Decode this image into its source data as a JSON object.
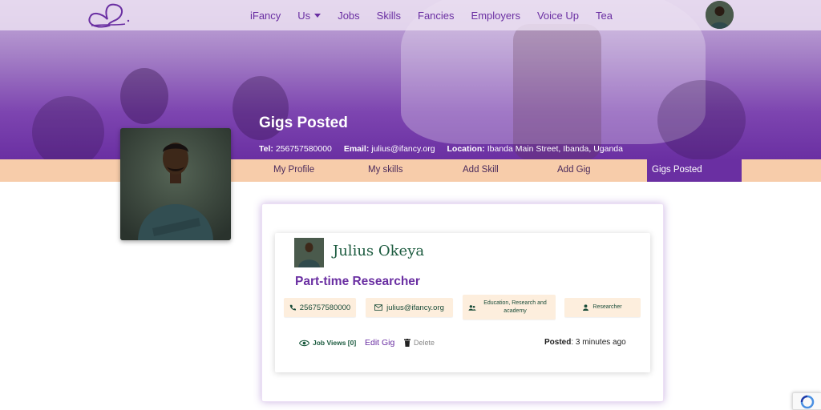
{
  "nav": {
    "items": [
      "iFancy",
      "Us",
      "Jobs",
      "Skills",
      "Fancies",
      "Employers",
      "Voice Up",
      "Tea"
    ]
  },
  "header": {
    "title": "Gigs Posted",
    "tel_label": "Tel:",
    "tel_value": "256757580000",
    "email_label": "Email:",
    "email_value": "julius@ifancy.org",
    "location_label": "Location:",
    "location_value": "Ibanda Main Street, Ibanda, Uganda"
  },
  "tabs": [
    "My Profile",
    "My skills",
    "Add Skill",
    "Add Gig",
    "Gigs Posted"
  ],
  "gig": {
    "poster_name": "Julius Okeya",
    "title": "Part-time Researcher",
    "phone": "256757580000",
    "email": "julius@ifancy.org",
    "category": "Education, Research and academy",
    "role": "Researcher",
    "job_views_label": "Job Views [0]",
    "edit_label": "Edit Gig",
    "delete_label": "Delete",
    "posted_label": "Posted",
    "posted_value": ": 3 minutes ago"
  },
  "colors": {
    "brand_purple": "#6a2fa2",
    "tab_bar": "#f7ccaa",
    "chip_bg": "#fdeedd",
    "green_text": "#1b5a3e"
  }
}
